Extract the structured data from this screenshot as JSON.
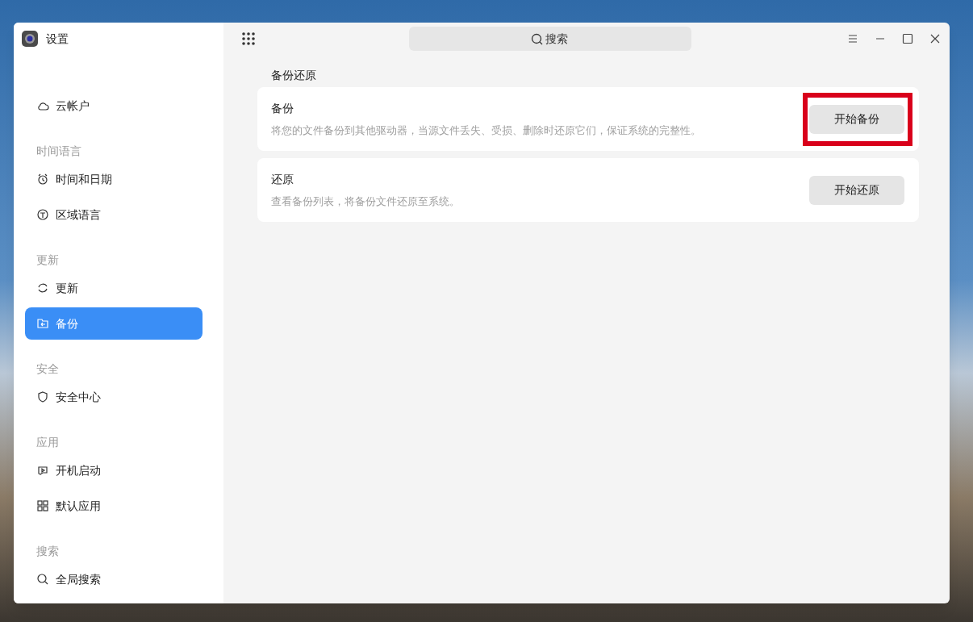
{
  "window": {
    "title": "设置"
  },
  "search": {
    "placeholder": "搜索"
  },
  "sidebar": {
    "groups": [
      {
        "items": [
          {
            "label": "云帐户",
            "selected": false
          }
        ]
      },
      {
        "heading": "时间语言",
        "items": [
          {
            "label": "时间和日期",
            "selected": false
          },
          {
            "label": "区域语言",
            "selected": false
          }
        ]
      },
      {
        "heading": "更新",
        "items": [
          {
            "label": "更新",
            "selected": false
          },
          {
            "label": "备份",
            "selected": true
          }
        ]
      },
      {
        "heading": "安全",
        "items": [
          {
            "label": "安全中心",
            "selected": false
          }
        ]
      },
      {
        "heading": "应用",
        "items": [
          {
            "label": "开机启动",
            "selected": false
          },
          {
            "label": "默认应用",
            "selected": false
          }
        ]
      },
      {
        "heading": "搜索",
        "items": [
          {
            "label": "全局搜索",
            "selected": false
          }
        ]
      }
    ]
  },
  "content": {
    "title": "备份还原",
    "cards": [
      {
        "title": "备份",
        "description": "将您的文件备份到其他驱动器，当源文件丢失、受损、删除时还原它们，保证系统的完整性。",
        "button": "开始备份",
        "highlighted": true
      },
      {
        "title": "还原",
        "description": "查看备份列表，将备份文件还原至系统。",
        "button": "开始还原",
        "highlighted": false
      }
    ]
  }
}
